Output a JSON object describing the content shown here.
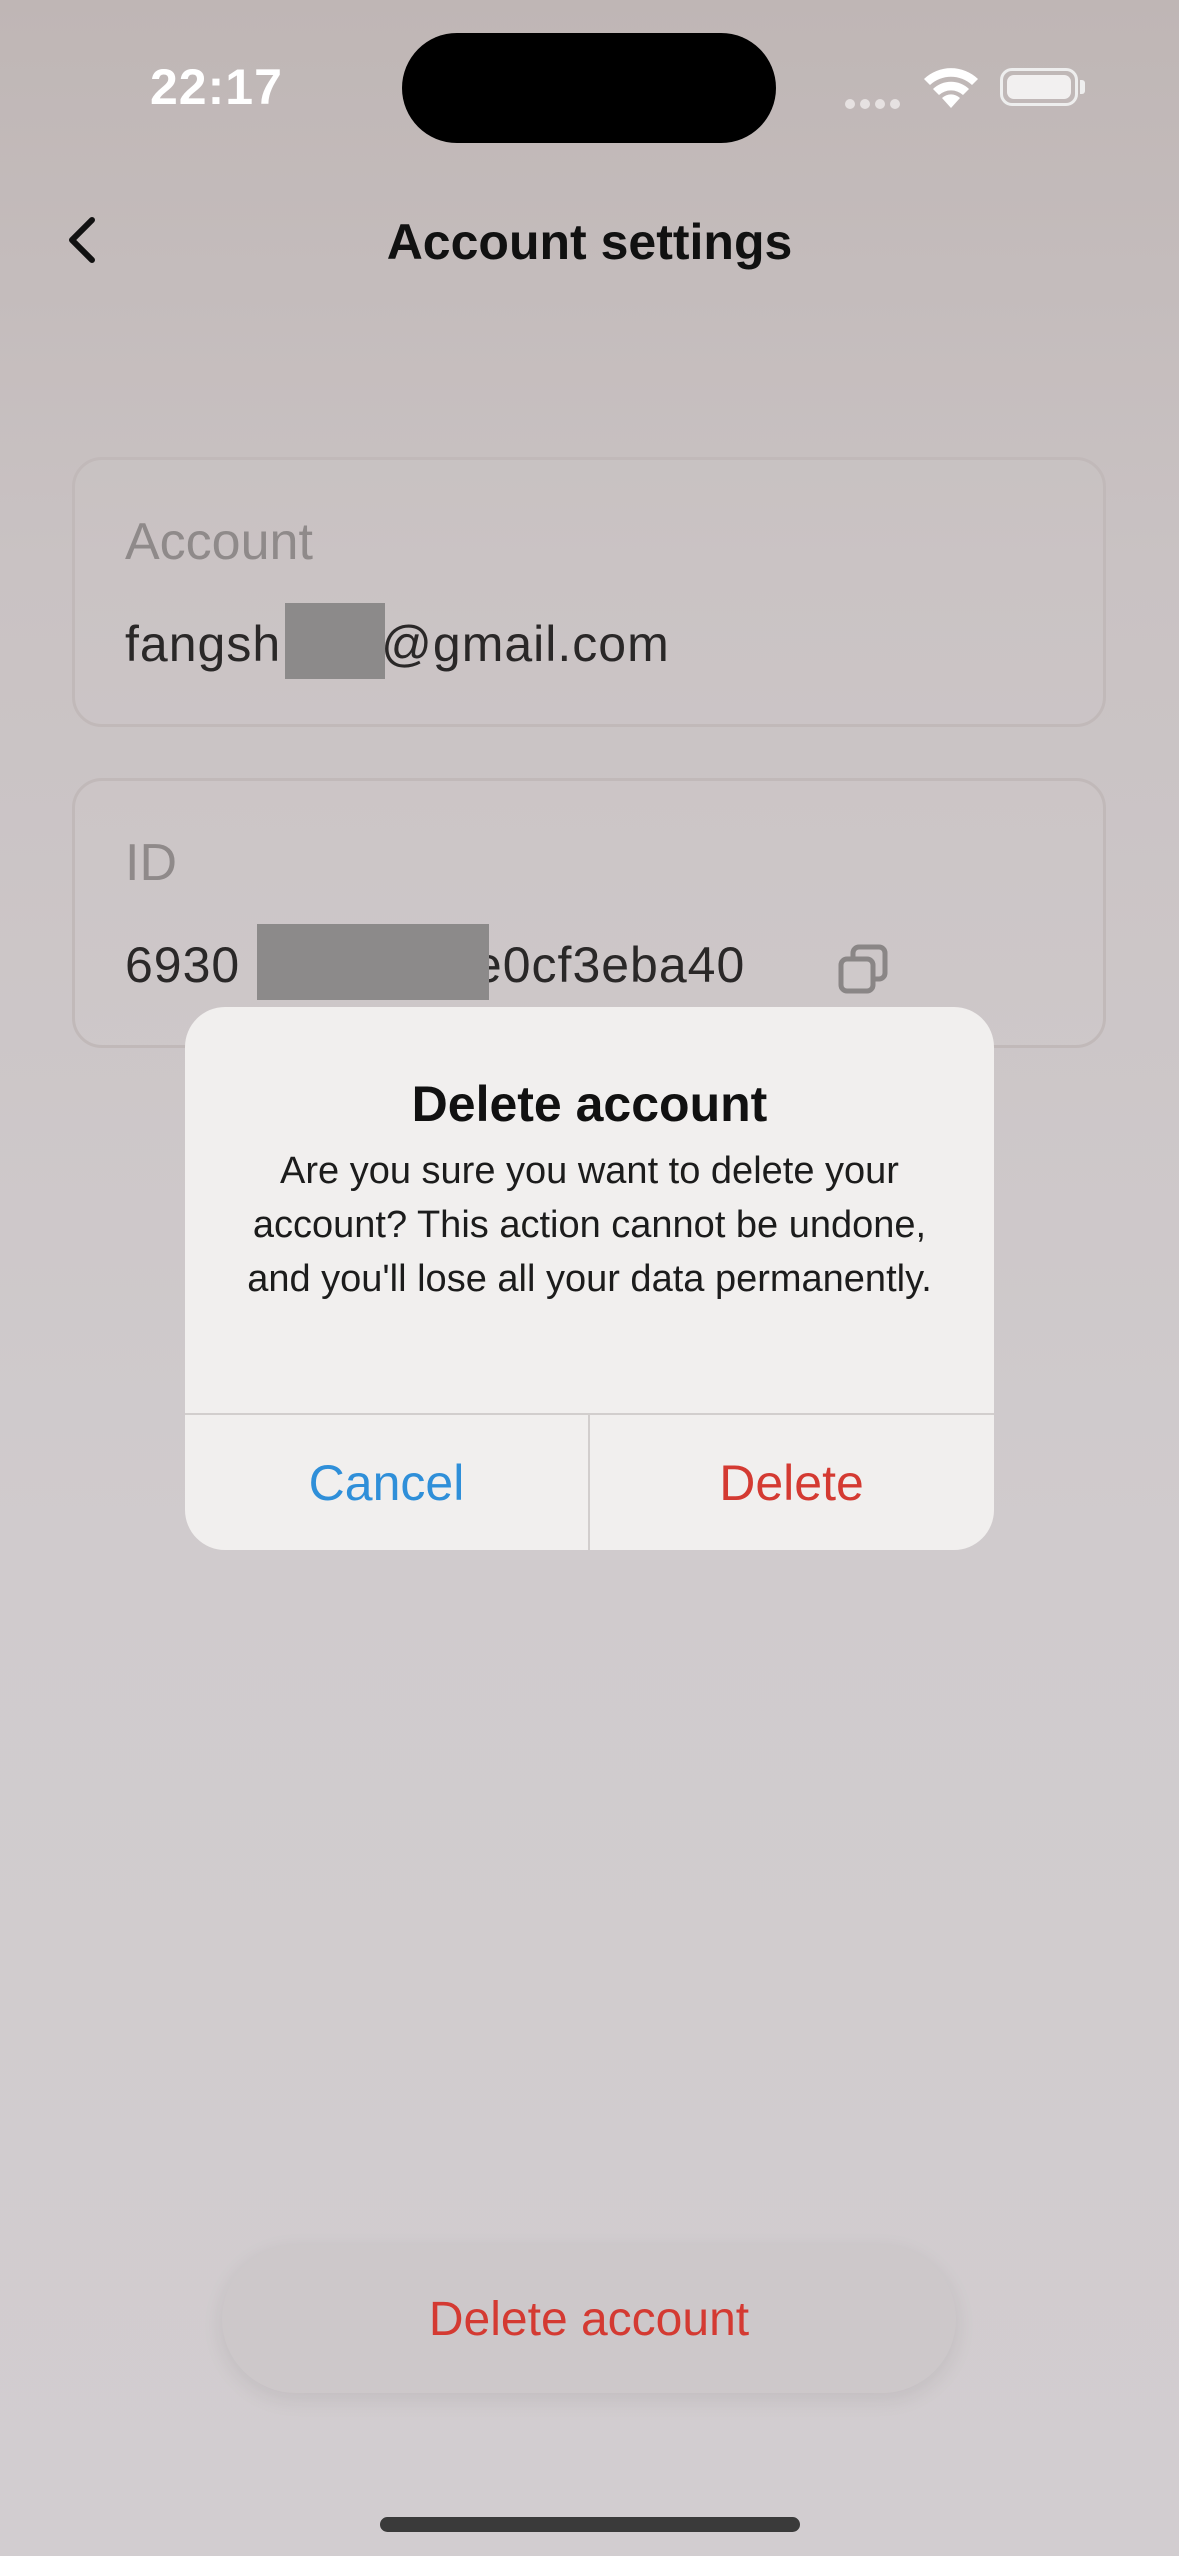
{
  "status_bar": {
    "time": "22:17"
  },
  "nav": {
    "title": "Account settings"
  },
  "account_card": {
    "label": "Account",
    "value_prefix": "fangsh",
    "value_suffix": "@gmail.com"
  },
  "id_card": {
    "label": "ID",
    "value_prefix": "6930",
    "value_suffix": "pfe0cf3eba40"
  },
  "dialog": {
    "title": "Delete account",
    "message": "Are you sure you want to delete your account? This action cannot be undone, and you'll lose all your data permanently.",
    "cancel_label": "Cancel",
    "delete_label": "Delete"
  },
  "footer": {
    "delete_account_label": "Delete account"
  },
  "colors": {
    "danger": "#d43a32",
    "link": "#2f8fd9"
  }
}
